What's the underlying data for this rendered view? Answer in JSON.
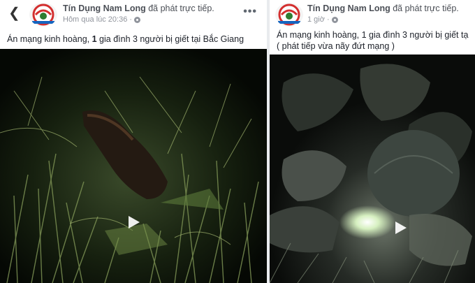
{
  "left_post": {
    "page_name": "Tín Dụng Nam Long",
    "action_text": "đã phát trực tiếp.",
    "timestamp": "Hôm qua lúc 20:36",
    "separator": "·",
    "caption_prefix": "Án mạng kinh hoàng, ",
    "caption_bold": "1",
    "caption_suffix": " gia đình 3 người bị giết tại Bắc Giang",
    "back_icon": "back-arrow-icon",
    "more_icon": "more-options-icon",
    "play_icon": "play-icon"
  },
  "right_post": {
    "page_name": "Tín Dụng Nam Long",
    "action_text": "đã phát trực tiếp.",
    "timestamp": "1 giờ",
    "separator": "·",
    "caption_line1": "Án mạng kinh hoàng, 1 gia đình 3 người bị giết tạ",
    "caption_line2": "( phát tiếp vừa nãy đứt mạng )",
    "play_icon": "play-icon"
  },
  "colors": {
    "text_primary": "#1d2129",
    "text_secondary": "#90949c",
    "avatar_red": "#d32f2f",
    "video_dark": "#0b1208"
  }
}
